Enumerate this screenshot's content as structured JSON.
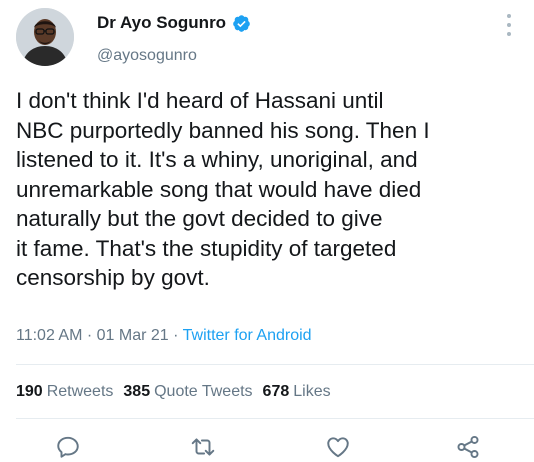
{
  "author": {
    "display_name": "Dr Ayo Sogunro",
    "handle": "@ayosogunro",
    "verified": true
  },
  "tweet": {
    "lines": [
      "I don't think I'd heard of Hassani until",
      "NBC purportedly banned his song. Then I",
      "listened to it. It's a whiny, unoriginal, and",
      "unremarkable song that would have died",
      "naturally but the govt decided to give",
      "it fame. That's the stupidity of targeted",
      "censorship by govt."
    ]
  },
  "meta": {
    "time": "11:02 AM",
    "sep1": " · ",
    "date": "01 Mar 21",
    "sep2": " · ",
    "source": "Twitter for Android"
  },
  "stats": {
    "retweets_count": "190",
    "retweets_label": "Retweets",
    "quotes_count": "385",
    "quotes_label": "Quote Tweets",
    "likes_count": "678",
    "likes_label": "Likes"
  },
  "icons": {
    "reply": "reply-icon",
    "retweet": "retweet-icon",
    "like": "like-icon",
    "share": "share-icon",
    "more": "more-vertical-icon",
    "verified": "verified-badge-icon"
  },
  "colors": {
    "text": "#14171a",
    "secondary": "#657786",
    "accent": "#1da1f2",
    "divider": "#e6ecf0"
  }
}
